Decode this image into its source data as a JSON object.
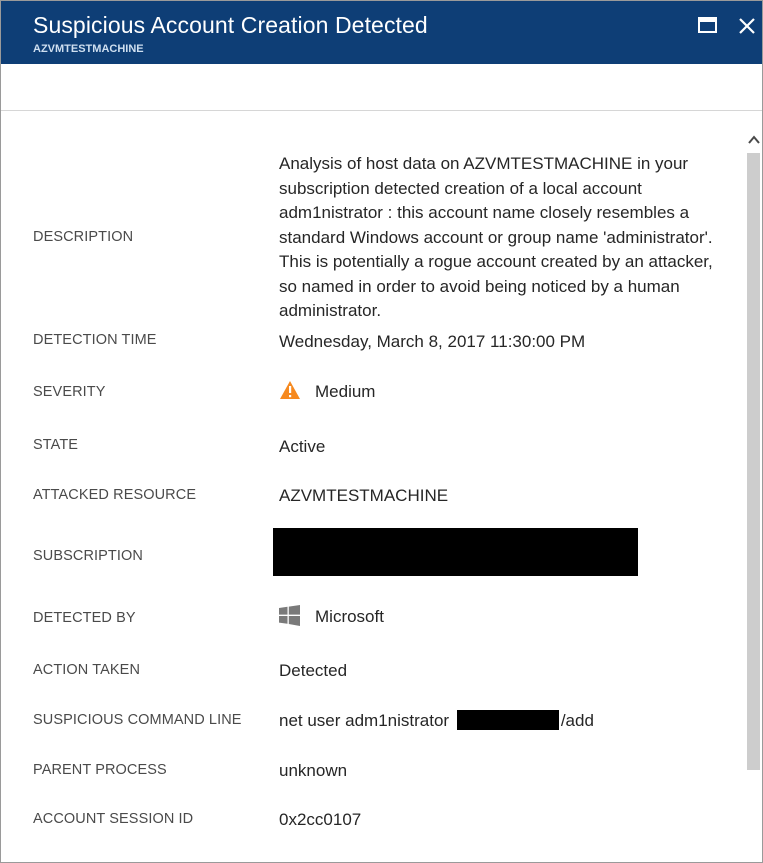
{
  "header": {
    "title": "Suspicious Account Creation Detected",
    "subtitle": "AZVMTESTMACHINE"
  },
  "details": {
    "description_label": "DESCRIPTION",
    "description": "Analysis of host data on AZVMTESTMACHINE in your subscription detected creation of a local account adm1nistrator : this account name closely resembles a standard Windows account or group name 'administrator'. This is potentially a rogue account created by an attacker, so named in order to avoid being noticed by a human administrator.",
    "detection_time_label": "DETECTION TIME",
    "detection_time": "Wednesday, March 8, 2017 11:30:00 PM",
    "severity_label": "SEVERITY",
    "severity": "Medium",
    "state_label": "STATE",
    "state": "Active",
    "attacked_resource_label": "ATTACKED RESOURCE",
    "attacked_resource": "AZVMTESTMACHINE",
    "subscription_label": "SUBSCRIPTION",
    "detected_by_label": "DETECTED BY",
    "detected_by": "Microsoft",
    "action_taken_label": "ACTION TAKEN",
    "action_taken": "Detected",
    "command_line_label": "SUSPICIOUS COMMAND LINE",
    "command_line_prefix": "net  user adm1nistrator",
    "command_line_suffix": "/add",
    "parent_process_label": "PARENT PROCESS",
    "parent_process": "unknown",
    "session_id_label": "ACCOUNT SESSION ID",
    "session_id": "0x2cc0107"
  },
  "colors": {
    "header_bg": "#0e3e76",
    "warning": "#f6891f",
    "windows_logo": "#7a7a7a",
    "redaction": "#000000"
  },
  "icons": {
    "maximize": "maximize-icon",
    "close": "close-icon",
    "severity": "warning-triangle-icon",
    "detected_by": "windows-logo-icon",
    "scroll_up": "chevron-up-icon"
  }
}
